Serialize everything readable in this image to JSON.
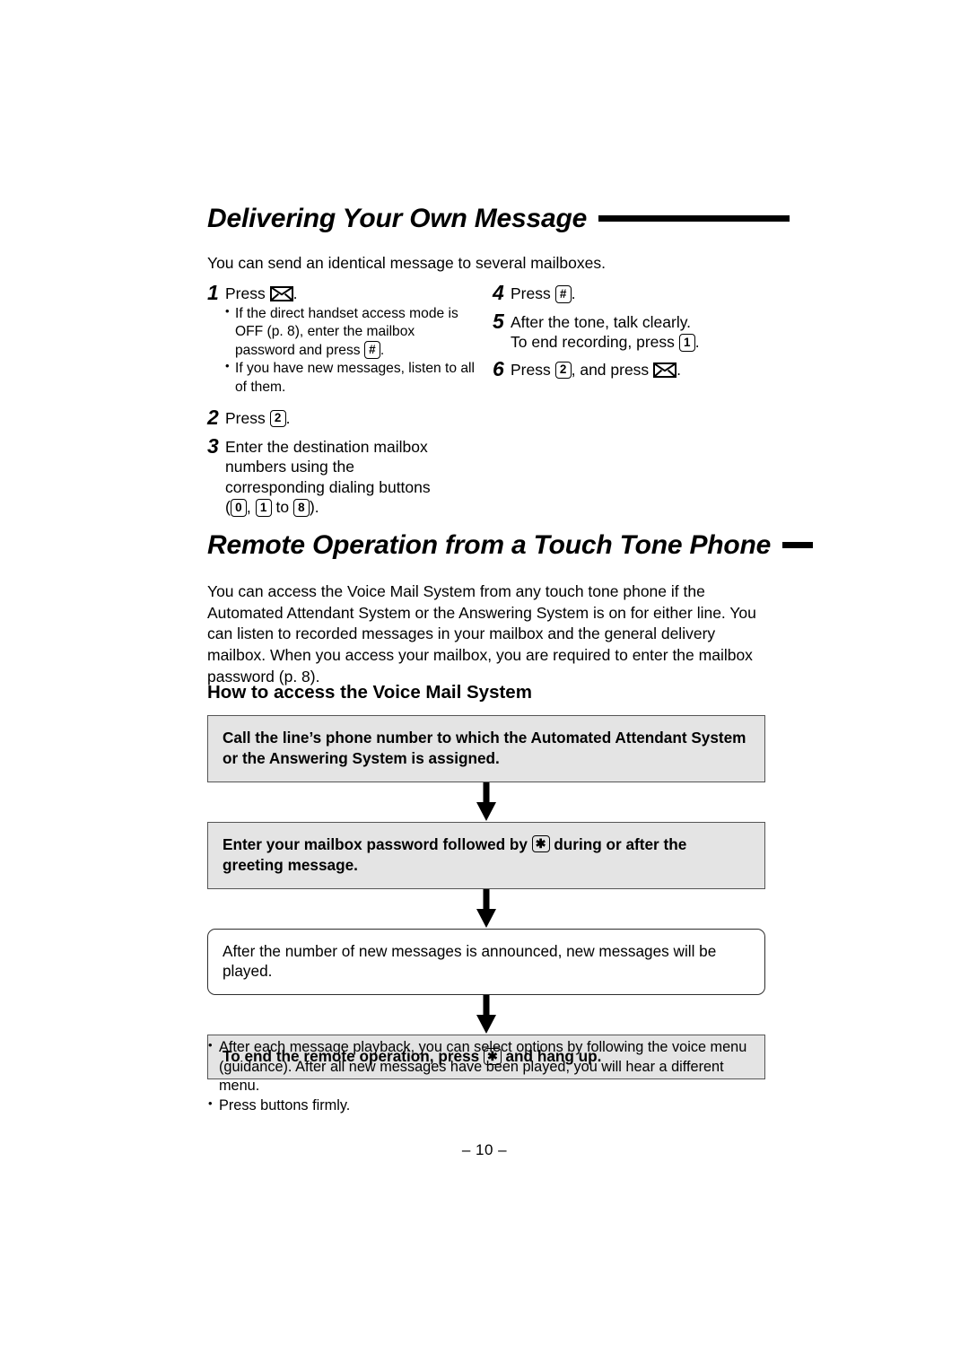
{
  "page": {
    "folio": "– 10 –"
  },
  "section1": {
    "heading": "Delivering Your Own Message",
    "intro": "You can send an identical message to several mailboxes.",
    "steps_left": [
      {
        "num": "1",
        "text_before": "Press",
        "icon": "envelope-icon",
        "text_after": ".",
        "subs": [
          "If the direct handset access mode is OFF (p. 8), enter the mailbox password and press",
          "If you have new messages, listen to all of them."
        ],
        "sub1_key": "#",
        "sub1_tail": "."
      },
      {
        "num": "2",
        "text_before": "Press",
        "key": "2",
        "text_after": "."
      },
      {
        "num": "3",
        "line1": "Enter the destination mailbox",
        "line2": "numbers using the",
        "line3": "corresponding dialing buttons",
        "keys": [
          "0",
          "1",
          "8"
        ],
        "sep": ",",
        "to_word": "to",
        "open_paren": "(",
        "close_paren": ")."
      }
    ],
    "steps_right": [
      {
        "num": "4",
        "text_before": "Press",
        "key": "#",
        "text_after": "."
      },
      {
        "num": "5",
        "line1": "After the tone, talk clearly.",
        "line2_before": "To end recording, press",
        "key": "1",
        "line2_after": "."
      },
      {
        "num": "6",
        "text_before": "Press",
        "key": "2",
        "mid": ", and press",
        "icon": "envelope-icon",
        "text_after": "."
      }
    ]
  },
  "section2": {
    "heading": "Remote Operation from a Touch Tone Phone",
    "paragraph": "You can access the Voice Mail System from any touch tone phone if the Automated Attendant System or the Answering System is on for either line. You can listen to recorded messages in your mailbox and the general delivery mailbox. When you access your mailbox, you are required to enter the mailbox password (p. 8).",
    "subheading": "How to access the Voice Mail System",
    "flow": [
      {
        "style": "gray-bold",
        "text": "Call the line’s phone number to which the Automated Attendant System or the Answering System is assigned."
      },
      {
        "style": "gray-bold",
        "text_before": "Enter your mailbox password followed by",
        "key": "✱",
        "text_after": "during or after the greeting message."
      },
      {
        "style": "white-plain",
        "text": "After the number of new messages is announced, new messages will be played."
      },
      {
        "style": "gray-bold",
        "text_before": "To end the remote operation, press",
        "key": "✱",
        "text_after": "and hang up."
      }
    ],
    "notes": [
      "After each message playback, you can select options by following the voice menu (guidance). After all new messages have been played, you will hear a different menu.",
      "Press buttons firmly."
    ]
  },
  "colors": {
    "box_fill_gray": "#e4e4e4",
    "box_border": "#4a4a4a",
    "text": "#000000",
    "page_bg": "#ffffff"
  }
}
